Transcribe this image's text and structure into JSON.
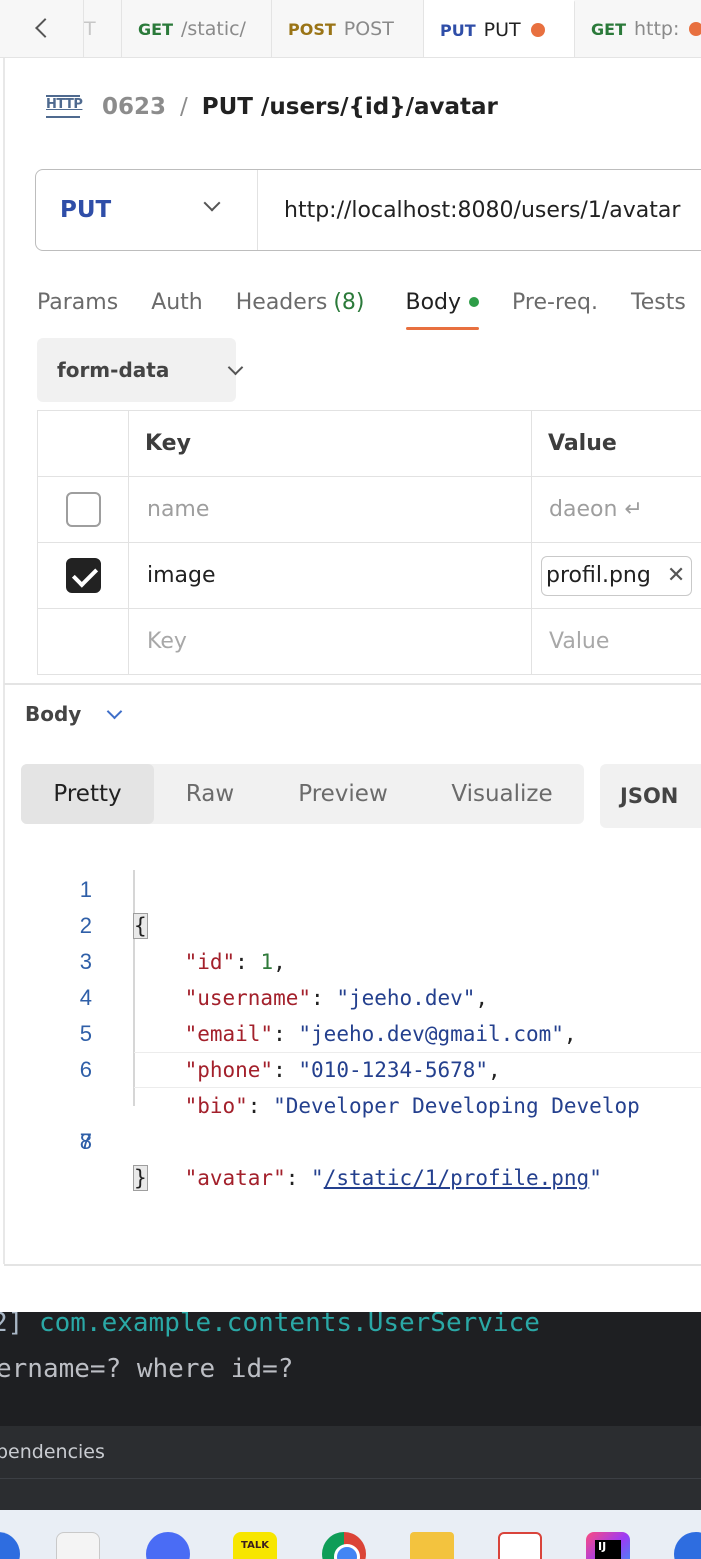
{
  "tabs": {
    "ghost_label": "T",
    "items": [
      {
        "method": "GET",
        "name": "/static/",
        "method_color": "#2b7a3a",
        "active": false,
        "unsaved": false
      },
      {
        "method": "POST",
        "name": "POST",
        "method_color": "#9a7416",
        "active": false,
        "unsaved": false
      },
      {
        "method": "PUT",
        "name": "PUT",
        "method_color": "#2f4ea8",
        "active": true,
        "unsaved": true
      },
      {
        "method": "GET",
        "name": "http:",
        "method_color": "#2b7a3a",
        "active": false,
        "unsaved": true
      }
    ]
  },
  "breadcrumb": {
    "icon_label": "HTTP",
    "collection": "0623",
    "separator": "/",
    "request": "PUT /users/{id}/avatar"
  },
  "request": {
    "method": "PUT",
    "url": "http://localhost:8080/users/1/avatar"
  },
  "request_tabs": [
    {
      "label": "Params"
    },
    {
      "label": "Auth"
    },
    {
      "label": "Headers",
      "count": "(8)"
    },
    {
      "label": "Body",
      "active": true,
      "indicator": true
    },
    {
      "label": "Pre-req."
    },
    {
      "label": "Tests"
    }
  ],
  "body_type": "form-data",
  "form_table": {
    "headers": {
      "key": "Key",
      "value": "Value"
    },
    "rows": [
      {
        "checked": false,
        "key": "name",
        "value": "daeon ↵"
      },
      {
        "checked": true,
        "key": "image",
        "file": "profil.png"
      }
    ],
    "placeholder": {
      "key": "Key",
      "value": "Value"
    }
  },
  "response": {
    "section_label": "Body",
    "views": [
      "Pretty",
      "Raw",
      "Preview",
      "Visualize"
    ],
    "active_view": "Pretty",
    "format": "JSON",
    "lines": [
      {
        "n": "1",
        "open": "{"
      },
      {
        "n": "2",
        "k": "\"id\"",
        "colon": ": ",
        "num": "1",
        "end": ","
      },
      {
        "n": "3",
        "k": "\"username\"",
        "colon": ": ",
        "s": "\"jeeho.dev\"",
        "end": ","
      },
      {
        "n": "4",
        "k": "\"email\"",
        "colon": ": ",
        "s": "\"jeeho.dev@gmail.com\"",
        "end": ","
      },
      {
        "n": "5",
        "k": "\"phone\"",
        "colon": ": ",
        "s": "\"010-1234-5678\"",
        "end": ","
      },
      {
        "n": "6",
        "k": "\"bio\"",
        "colon": ": ",
        "s": "\"Developer Developing Develop",
        "end": ""
      },
      {
        "n": "7",
        "k": "\"avatar\"",
        "colon": ": ",
        "q1": "\"",
        "link": "/static/1/profile.png",
        "q2": "\""
      },
      {
        "n": "8",
        "close": "}"
      }
    ]
  },
  "console": {
    "line1_prefix": "2]",
    "line1_class": "com.example.contents.UserService",
    "line2": "ername=? where id=?",
    "deps_label": "pendencies"
  },
  "taskbar": {
    "kakao_label": "TALK",
    "idea_label": "IJ",
    "icons": [
      "edge-icon",
      "files-icon",
      "zoom-icon",
      "kakaotalk-icon",
      "chrome-icon",
      "folder-icon",
      "app-icon",
      "intellij-icon",
      "app-icon"
    ]
  },
  "colors": {
    "accent": "#e8703f",
    "put": "#2f4ea8",
    "get": "#2b7a3a",
    "post": "#9a7416",
    "json_key": "#a3202b",
    "json_string": "#24408e",
    "json_number": "#2f7a3a"
  }
}
